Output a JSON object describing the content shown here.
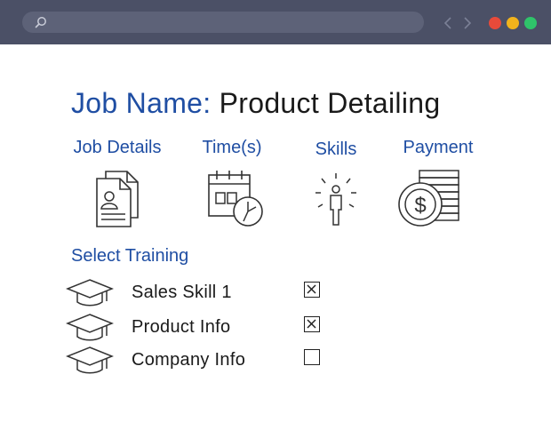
{
  "header": {
    "title_prefix": "Job Name:",
    "title_value": "Product Detailing"
  },
  "tabs": [
    {
      "label": "Job Details",
      "icon": "documents-icon"
    },
    {
      "label": "Time(s)",
      "icon": "calendar-clock-icon"
    },
    {
      "label": "Skills",
      "icon": "person-radiant-icon"
    },
    {
      "label": "Payment",
      "icon": "coin-stack-icon"
    }
  ],
  "training": {
    "label": "Select Training",
    "items": [
      {
        "name": "Sales Skill 1",
        "checked": true
      },
      {
        "name": "Product Info",
        "checked": true
      },
      {
        "name": "Company Info",
        "checked": false
      }
    ]
  },
  "colors": {
    "accent": "#1f4ea3",
    "browser_bar": "#4b5066",
    "dot_red": "#e84a3a",
    "dot_yellow": "#f1b31c",
    "dot_green": "#2fc46a"
  }
}
